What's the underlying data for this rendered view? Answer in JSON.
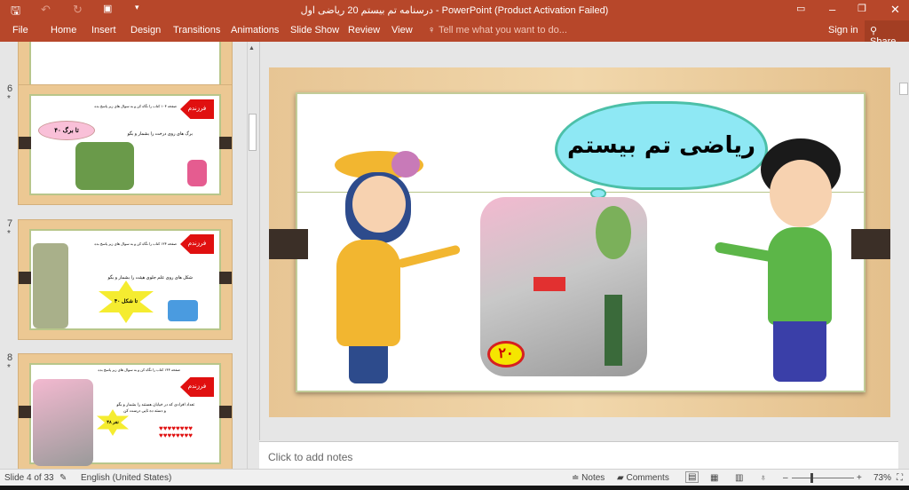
{
  "window": {
    "title": "درسنامه تم بیستم 20 ریاضی اول - PowerPoint (Product Activation Failed)"
  },
  "quick_access": {
    "icons": [
      "save-icon",
      "undo-icon",
      "redo-icon",
      "start-from-beginning-icon",
      "customize-icon"
    ]
  },
  "ribbon": {
    "tabs": [
      "File",
      "Home",
      "Insert",
      "Design",
      "Transitions",
      "Animations",
      "Slide Show",
      "Review",
      "View"
    ],
    "tell_me": "Tell me what you want to do...",
    "sign_in": "Sign in",
    "share": "Share"
  },
  "thumbnails": [
    {
      "number": "6",
      "star": "*",
      "badge": "فرزندم",
      "heading": "صفحه ۱۰۴ کتاب را نگاه کن و به سوال های زیر پاسخ بده",
      "bullet": "برگ های روی درخت را بشمار و بگو",
      "answer": "۴۰ تا برگ"
    },
    {
      "number": "7",
      "star": "*",
      "badge": "فرزندم",
      "heading": "صفحه ۱۳۴ کتاب را نگاه کن و به سوال های زیر پاسخ بده",
      "bullet": "شکل های روی علم جلوی هیئت را بشمار و بگو",
      "answer": "۴۰ تا شکل"
    },
    {
      "number": "8",
      "star": "*",
      "badge": "فرزندم",
      "heading": "صفحه ۱۴۴ کتاب را نگاه کن و به سوال های زیر پاسخ بده",
      "bullet": "تعداد افرادی که در خیابان هستند را بشمار و بگو",
      "bullet2": "و دسته ده تایی درست کن",
      "answer": "۴۸ نفر"
    }
  ],
  "slide": {
    "title": "ریاضی تم بیستم",
    "badge": "۲۰"
  },
  "notes": {
    "placeholder": "Click to add notes"
  },
  "status": {
    "slide": "Slide 4 of 33",
    "language": "English (United States)",
    "notes": "Notes",
    "comments": "Comments",
    "zoom": "73%",
    "zoom_level_percent": 73
  },
  "colors": {
    "accent": "#b7472a",
    "slide_wood": "#e9c898",
    "cloud": "#8ee8f4"
  }
}
